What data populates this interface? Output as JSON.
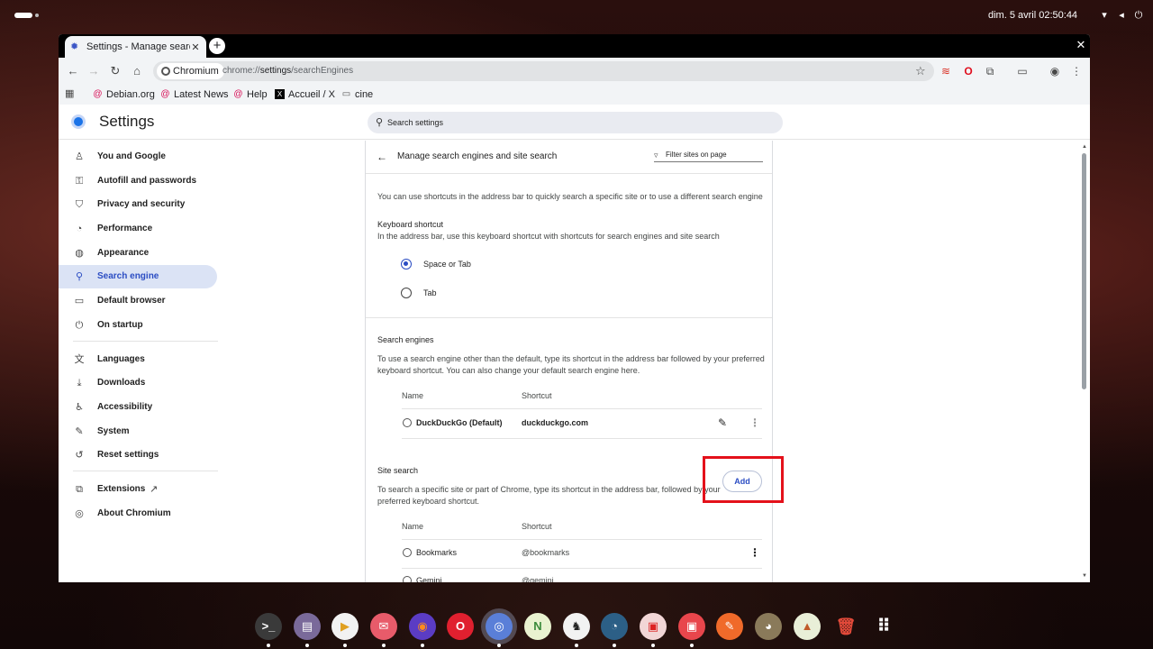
{
  "system": {
    "clock": "dim. 5 avril  02:50:44",
    "tray_icons": [
      "wifi-icon",
      "volume-icon",
      "power-icon"
    ]
  },
  "browser": {
    "tab_title": "Settings - Manage search engines and site search",
    "tab_close": "✕",
    "new_tab": "+",
    "window_close": "✕",
    "nav": {
      "back": "←",
      "forward": "→",
      "reload": "↻",
      "home": "⌂"
    },
    "site_chip": "Chromium",
    "url_scheme": "chrome://",
    "url_host": "settings",
    "url_path": "/searchEngines",
    "bookmark_star": "☆",
    "extensions": {
      "ext1": "≋",
      "opera": "O",
      "puzzle": "⧉",
      "media": "▭",
      "profile": "◉",
      "menu": "⋮"
    },
    "bookmarks": [
      {
        "label": "Debian.org",
        "icon": "debian-icon"
      },
      {
        "label": "Latest News",
        "icon": "debian-icon"
      },
      {
        "label": "Help",
        "icon": "debian-icon"
      },
      {
        "label": "Accueil / X",
        "icon": "x-icon"
      },
      {
        "label": "cine",
        "icon": "folder-icon"
      }
    ]
  },
  "settings": {
    "title": "Settings",
    "search_placeholder": "Search settings",
    "sidebar": [
      {
        "label": "You and Google",
        "icon": "person-icon"
      },
      {
        "label": "Autofill and passwords",
        "icon": "key-icon"
      },
      {
        "label": "Privacy and security",
        "icon": "shield-icon"
      },
      {
        "label": "Performance",
        "icon": "gauge-icon"
      },
      {
        "label": "Appearance",
        "icon": "palette-icon"
      },
      {
        "label": "Search engine",
        "icon": "search-icon",
        "active": true
      },
      {
        "label": "Default browser",
        "icon": "browser-icon"
      },
      {
        "label": "On startup",
        "icon": "power-icon"
      },
      {
        "label": "Languages",
        "icon": "translate-icon"
      },
      {
        "label": "Downloads",
        "icon": "download-icon"
      },
      {
        "label": "Accessibility",
        "icon": "accessibility-icon"
      },
      {
        "label": "System",
        "icon": "wrench-icon"
      },
      {
        "label": "Reset settings",
        "icon": "reset-icon"
      },
      {
        "label": "Extensions",
        "icon": "puzzle-icon"
      },
      {
        "label": "About Chromium",
        "icon": "chromium-icon"
      }
    ],
    "page": {
      "title": "Manage search engines and site search",
      "filter_placeholder": "Filter sites on page",
      "intro": "You can use shortcuts in the address bar to quickly search a specific site or to use a different search engine",
      "keyboard_shortcut": {
        "heading": "Keyboard shortcut",
        "description": "In the address bar, use this keyboard shortcut with shortcuts for search engines and site search",
        "options": [
          {
            "label": "Space or Tab",
            "checked": true
          },
          {
            "label": "Tab",
            "checked": false
          }
        ]
      },
      "search_engines": {
        "heading": "Search engines",
        "description_line1": "To use a search engine other than the default, type its shortcut in the address bar followed by your preferred",
        "description_line2": "keyboard shortcut. You can also change your default search engine here.",
        "col_name": "Name",
        "col_shortcut": "Shortcut",
        "rows": [
          {
            "name": "DuckDuckGo (Default)",
            "shortcut": "duckduckgo.com"
          }
        ]
      },
      "site_search": {
        "heading": "Site search",
        "add_label": "Add",
        "description_line1": "To search a specific site or part of Chrome, type its shortcut in the address bar, followed by your",
        "description_line2": "preferred keyboard shortcut.",
        "col_name": "Name",
        "col_shortcut": "Shortcut",
        "rows": [
          {
            "name": "Bookmarks",
            "shortcut": "@bookmarks"
          },
          {
            "name": "Gemini",
            "shortcut": "@gemini"
          }
        ]
      }
    }
  },
  "dock": [
    {
      "name": "terminal",
      "glyph": ">_",
      "color": "#3a3a3a"
    },
    {
      "name": "files",
      "glyph": "▤",
      "color": "#7a6a9a"
    },
    {
      "name": "video-player",
      "glyph": "▶",
      "color": "#f2f2f2"
    },
    {
      "name": "mail",
      "glyph": "✉",
      "color": "#e85b6a"
    },
    {
      "name": "firefox",
      "glyph": "◉",
      "color": "#5b3cc4"
    },
    {
      "name": "opera",
      "glyph": "O",
      "color": "#e0202f"
    },
    {
      "name": "chromium",
      "glyph": "◎",
      "color": "#5a7fd8",
      "active": true
    },
    {
      "name": "notes",
      "glyph": "N",
      "color": "#e9f2d0"
    },
    {
      "name": "inkscape",
      "glyph": "♞",
      "color": "#f2f2f2"
    },
    {
      "name": "blender",
      "glyph": "◔",
      "color": "#2c5f86"
    },
    {
      "name": "app-red-1",
      "glyph": "▣",
      "color": "#f2d6d6"
    },
    {
      "name": "app-red-2",
      "glyph": "▣",
      "color": "#e8464c"
    },
    {
      "name": "feather",
      "glyph": "✎",
      "color": "#f06a2a"
    },
    {
      "name": "gimp",
      "glyph": "◕",
      "color": "#8a7a5a"
    },
    {
      "name": "maps",
      "glyph": "▲",
      "color": "#e9efd8"
    },
    {
      "name": "trash",
      "glyph": "🗑",
      "color": "rgba(0,0,0,0)"
    },
    {
      "name": "app-grid",
      "glyph": "⠿",
      "color": "rgba(0,0,0,0)"
    }
  ],
  "colors": {
    "accent": "#2b4dc3",
    "highlight": "#e4111b"
  }
}
